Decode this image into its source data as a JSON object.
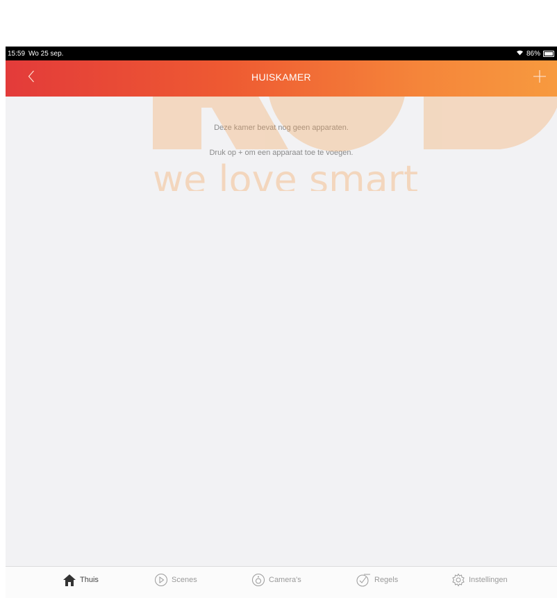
{
  "status_bar": {
    "time": "15:59",
    "date": "Wo 25 sep.",
    "battery": "86%"
  },
  "nav": {
    "title": "HUISKAMER",
    "back_icon": "chevron-left-icon",
    "add_icon": "plus-icon"
  },
  "empty_state": {
    "line1": "Deze kamer bevat nog geen apparaten.",
    "line2": "Druk op + om een apparaat toe te voegen."
  },
  "watermark": {
    "letters": "ROB",
    "tagline": "we love smart",
    "color": "#f5a55a"
  },
  "tabs": [
    {
      "label": "Thuis",
      "icon": "home-icon",
      "active": true
    },
    {
      "label": "Scenes",
      "icon": "play-circle-icon",
      "active": false
    },
    {
      "label": "Camera's",
      "icon": "camera-icon",
      "active": false
    },
    {
      "label": "Regels",
      "icon": "check-rules-icon",
      "active": false
    },
    {
      "label": "Instellingen",
      "icon": "gear-icon",
      "active": false
    }
  ],
  "colors": {
    "accent_start": "#e33b3a",
    "accent_end": "#f79a3f",
    "background": "#f2f2f4"
  }
}
